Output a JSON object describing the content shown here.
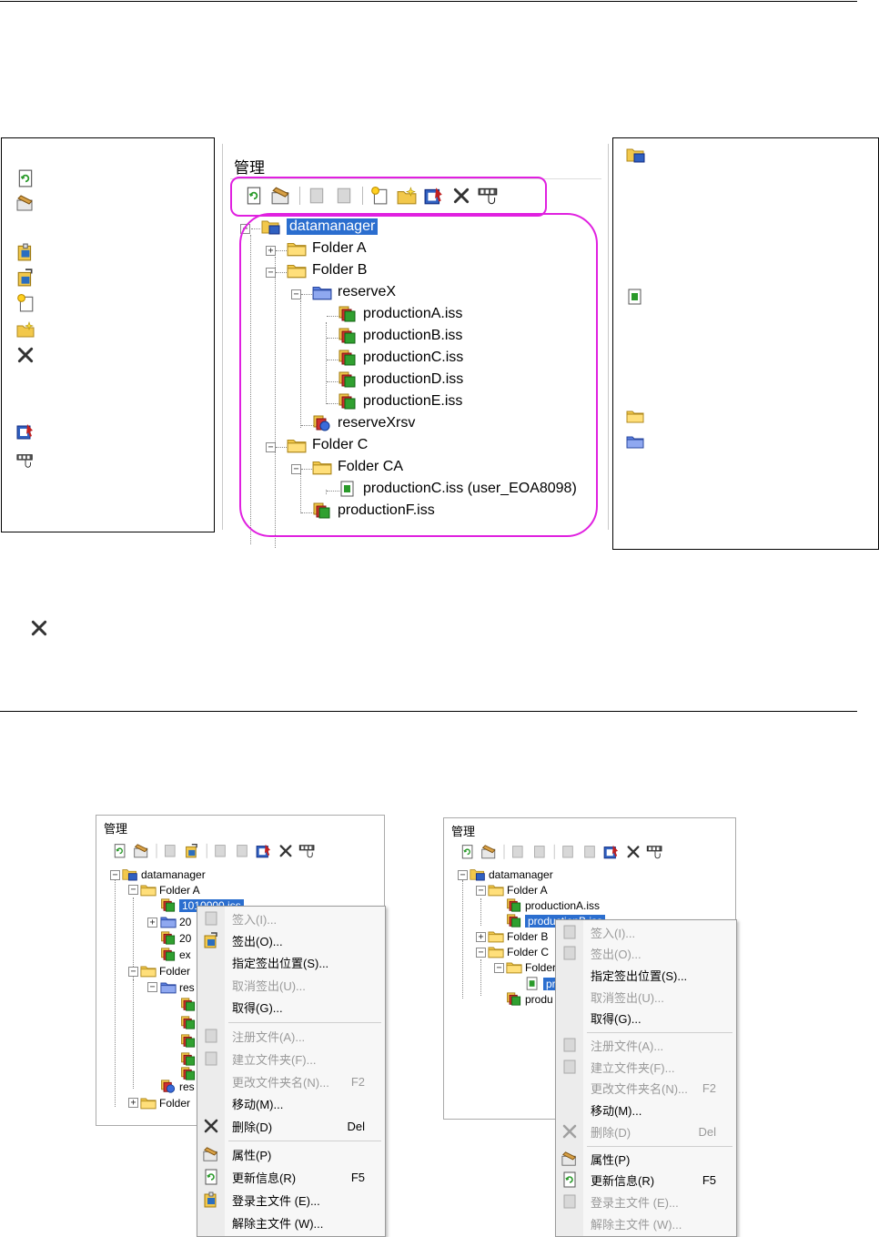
{
  "panel": {
    "title": "管理"
  },
  "tree": {
    "root": "datamanager",
    "nodes": [
      "Folder A",
      "Folder B",
      "reserveX",
      "productionA.iss",
      "productionB.iss",
      "productionC.iss",
      "productionD.iss",
      "productionE.iss",
      "reserveXrsv",
      "Folder C",
      "Folder CA",
      "productionC.iss (user_EOA8098)",
      "productionF.iss"
    ]
  },
  "shot1": {
    "title": "管理",
    "root": "datamanager",
    "nodes": [
      "Folder A",
      "1010000.iss",
      "20",
      "20",
      "ex",
      "Folder",
      "res",
      "res",
      "Folder"
    ]
  },
  "shot2": {
    "title": "管理",
    "root": "datamanager",
    "nodes": [
      "Folder A",
      "productionA.iss",
      "productionB.iss",
      "Folder B",
      "Folder C",
      "Folder",
      "pr",
      "produ"
    ]
  },
  "menu1": {
    "items": [
      {
        "label": "签入(I)...",
        "key": ""
      },
      {
        "label": "签出(O)...",
        "key": ""
      },
      {
        "label": "指定签出位置(S)...",
        "key": ""
      },
      {
        "label": "取消签出(U)...",
        "key": ""
      },
      {
        "label": "取得(G)...",
        "key": ""
      },
      {
        "label": "注册文件(A)...",
        "key": ""
      },
      {
        "label": "建立文件夹(F)...",
        "key": ""
      },
      {
        "label": "更改文件夹名(N)...",
        "key": "F2"
      },
      {
        "label": "移动(M)...",
        "key": ""
      },
      {
        "label": "删除(D)",
        "key": "Del"
      },
      {
        "label": "属性(P)",
        "key": ""
      },
      {
        "label": "更新信息(R)",
        "key": "F5"
      },
      {
        "label": "登录主文件 (E)...",
        "key": ""
      },
      {
        "label": "解除主文件 (W)...",
        "key": ""
      }
    ]
  },
  "menu2": {
    "items": [
      {
        "label": "签入(I)...",
        "key": ""
      },
      {
        "label": "签出(O)...",
        "key": ""
      },
      {
        "label": "指定签出位置(S)...",
        "key": ""
      },
      {
        "label": "取消签出(U)...",
        "key": ""
      },
      {
        "label": "取得(G)...",
        "key": ""
      },
      {
        "label": "注册文件(A)...",
        "key": ""
      },
      {
        "label": "建立文件夹(F)...",
        "key": ""
      },
      {
        "label": "更改文件夹名(N)...",
        "key": "F2"
      },
      {
        "label": "移动(M)...",
        "key": ""
      },
      {
        "label": "删除(D)",
        "key": "Del"
      },
      {
        "label": "属性(P)",
        "key": ""
      },
      {
        "label": "更新信息(R)",
        "key": "F5"
      },
      {
        "label": "登录主文件 (E)...",
        "key": ""
      },
      {
        "label": "解除主文件 (W)...",
        "key": ""
      }
    ]
  },
  "colors": {
    "selection": "#2b6ecf",
    "highlight_ring": "#e020e0",
    "folder": "#f2c84b",
    "blue_folder": "#5a7fe0"
  }
}
